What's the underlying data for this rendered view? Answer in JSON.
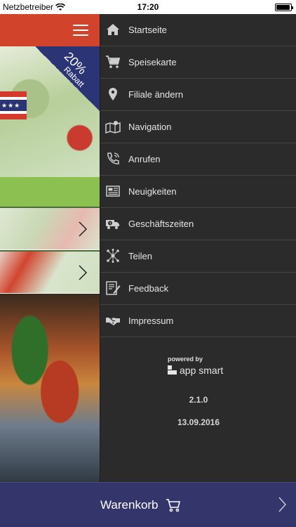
{
  "status_bar": {
    "carrier": "Netzbetreiber",
    "time": "17:20",
    "battery_level": 0.95
  },
  "app": {
    "badge": {
      "percent": "20%",
      "label": "Rabatt"
    },
    "flag_stars": "★★★"
  },
  "drawer": {
    "items": [
      {
        "label": "Startseite",
        "icon": "home-icon"
      },
      {
        "label": "Speisekarte",
        "icon": "cart-icon"
      },
      {
        "label": "Filiale ändern",
        "icon": "location-pin-icon"
      },
      {
        "label": "Navigation",
        "icon": "map-icon"
      },
      {
        "label": "Anrufen",
        "icon": "phone-icon"
      },
      {
        "label": "Neuigkeiten",
        "icon": "newspaper-icon"
      },
      {
        "label": "Geschäftszeiten",
        "icon": "delivery-truck-icon"
      },
      {
        "label": "Teilen",
        "icon": "share-network-icon"
      },
      {
        "label": "Feedback",
        "icon": "feedback-form-icon"
      },
      {
        "label": "Impressum",
        "icon": "handshake-icon"
      }
    ],
    "powered_by": "powered by",
    "brand": "app smart",
    "version": "2.1.0",
    "date": "13.09.2016"
  },
  "cart_bar": {
    "label": "Warenkorb"
  },
  "colors": {
    "header_red": "#d1432a",
    "drawer_bg": "#2b2b2b",
    "cart_bar_bg": "#34356b",
    "green_bar": "#8cc152"
  }
}
